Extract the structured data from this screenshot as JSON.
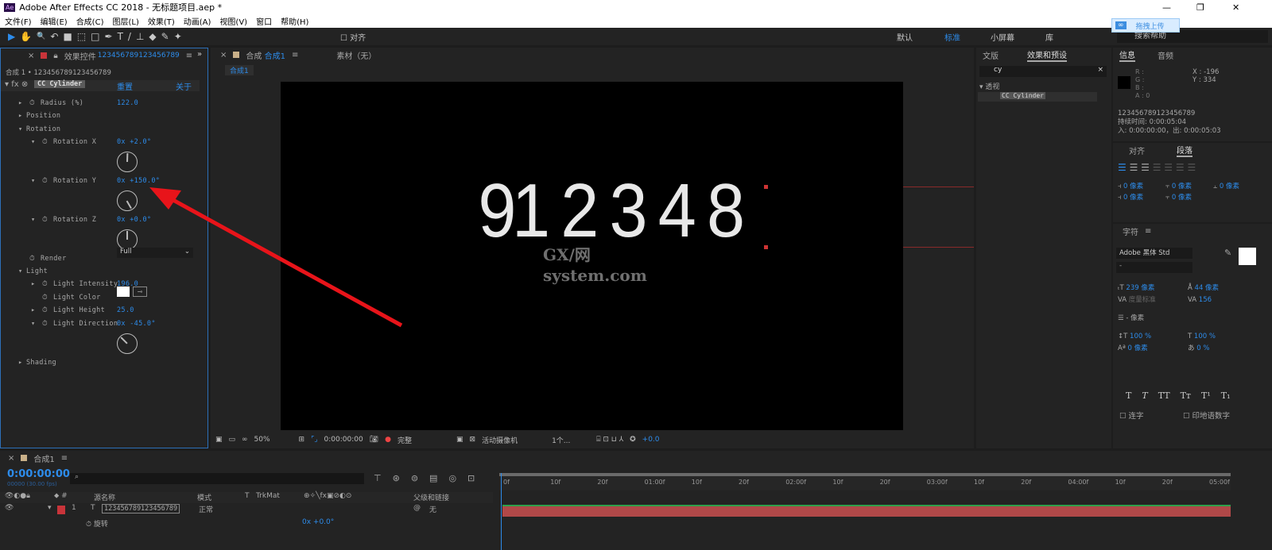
{
  "window": {
    "title": "Adobe After Effects CC 2018 - 无标题项目.aep *",
    "app_icon": "Ae"
  },
  "menu": [
    "文件(F)",
    "编辑(E)",
    "合成(C)",
    "图层(L)",
    "效果(T)",
    "动画(A)",
    "视图(V)",
    "窗口",
    "帮助(H)"
  ],
  "toolbar": {
    "tools": [
      "▶",
      "✋",
      "🔍",
      "↶",
      "■",
      "⬚",
      "□",
      "✒",
      "T",
      "/",
      "⊥",
      "◆",
      "✎",
      "✦"
    ],
    "align_label": "对齐",
    "workspaces": [
      "默认",
      "标准",
      "小屏幕",
      "库"
    ],
    "active_workspace": "标准",
    "search_help_placeholder": "搜索帮助",
    "upload_label": "拖拽上传"
  },
  "effect_controls": {
    "tab_title": "效果控件",
    "layer_name": "123456789123456789",
    "breadcrumb": "合成 1 • 123456789123456789",
    "effect_name": "CC Cylinder",
    "reset": "重置",
    "about": "关于",
    "props": [
      {
        "label": "Radius (%)",
        "value": "122.0"
      },
      {
        "label": "Position",
        "value": ""
      },
      {
        "label": "Rotation",
        "value": ""
      },
      {
        "label": "Rotation X",
        "value": "0x +2.0°",
        "angle": 2
      },
      {
        "label": "Rotation Y",
        "value": "0x +150.0°",
        "angle": 150
      },
      {
        "label": "Rotation Z",
        "value": "0x +0.0°",
        "angle": 0
      },
      {
        "label": "Render",
        "value": "Full"
      },
      {
        "label": "Light",
        "value": ""
      },
      {
        "label": "Light Intensity",
        "value": "196.0"
      },
      {
        "label": "Light Color",
        "value": ""
      },
      {
        "label": "Light Height",
        "value": "25.0"
      },
      {
        "label": "Light Direction",
        "value": "0x -45.0°",
        "angle": -45
      },
      {
        "label": "Shading",
        "value": ""
      }
    ]
  },
  "composition": {
    "tab_label": "合成",
    "comp_name": "合成1",
    "footage_tab": "素材（无）",
    "breadcrumb": "合成1",
    "viewer_text": "91 2 3 4 8",
    "watermark": "GX/网 system.com",
    "bottom": {
      "zoom": "50%",
      "timecode": "0:00:00:00",
      "resolution": "完整",
      "camera": "活动摄像机",
      "views": "1个...",
      "exposure": "+0.0"
    }
  },
  "effects_presets": {
    "tabs": [
      "文版",
      "效果和预设"
    ],
    "search_value": "cy",
    "category": "透视",
    "result": "CC Cylinder"
  },
  "info": {
    "tabs": [
      "信息",
      "音频"
    ],
    "r": "R :",
    "g": "G :",
    "b": "B :",
    "a": "A : 0",
    "x": "X : -196",
    "y": "Y : 334",
    "layer": "123456789123456789",
    "duration": "持续时间: 0:00:05:04",
    "inout": "入: 0:00:00:00，出: 0:00:05:03"
  },
  "paragraph": {
    "tabs": [
      "对齐",
      "段落"
    ],
    "fields": [
      "0 像素",
      "0 像素",
      "0 像素",
      "0 像素",
      "0 像素"
    ]
  },
  "character": {
    "title": "字符",
    "font": "Adobe 黑体 Std",
    "style": "-",
    "size": "239 像素",
    "leading": "44 像素",
    "kerning": "度量标准",
    "tracking": "156",
    "stroke": "- 像素",
    "vscale": "100 %",
    "hscale": "100 %",
    "baseline": "0 像素",
    "tsume": "0 %",
    "styles": [
      "T",
      "T",
      "TT",
      "Tт",
      "T¹",
      "T₁"
    ],
    "ligatures": "连字",
    "hindi": "印地语数字"
  },
  "timeline": {
    "tab": "合成1",
    "timecode": "0:00:00:00",
    "fps": "00000 (30.00 fps)",
    "columns": {
      "source": "源名称",
      "mode": "模式",
      "t": "T",
      "trkmat": "TrkMat",
      "parent": "父级和链接"
    },
    "layer": {
      "num": "1",
      "name": "123456789123456789",
      "mode": "正常",
      "parent": "无"
    },
    "sub": {
      "label": "旋转",
      "value": "0x +0.0°"
    },
    "ruler": [
      "0f",
      "10f",
      "20f",
      "01:00f",
      "10f",
      "20f",
      "02:00f",
      "10f",
      "20f",
      "03:00f",
      "10f",
      "20f",
      "04:00f",
      "10f",
      "20f",
      "05:00f"
    ]
  },
  "colors": {
    "accent": "#2d8ceb",
    "label_red": "#c8343a",
    "layer_bar": "#b04848",
    "arrow": "#e8141a"
  }
}
